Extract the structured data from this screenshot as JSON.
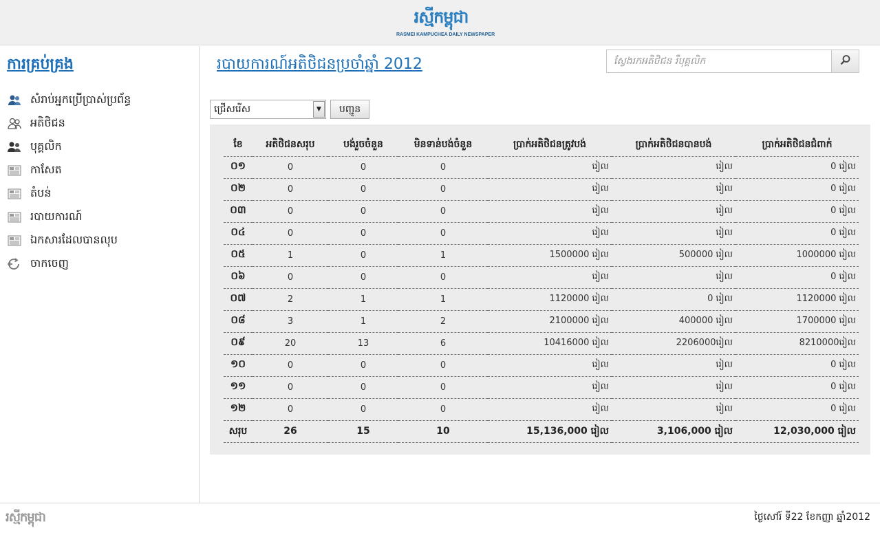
{
  "header": {
    "logo_main": "រស្មីកម្ពុជា",
    "logo_sub": "RASMEI KAMPUCHEA DAILY NEWSPAPER"
  },
  "sidebar": {
    "title": "ការគ្រប់គ្រង",
    "items": [
      {
        "label": "សំរាប់អ្នកប្រើប្រាស់ប្រព័ន្ធ",
        "icon": "users-icon"
      },
      {
        "label": "អតិថិជន",
        "icon": "customers-icon"
      },
      {
        "label": "បុគ្គលិក",
        "icon": "staff-icon"
      },
      {
        "label": "កាសែត",
        "icon": "newspaper-icon"
      },
      {
        "label": "តំបន់",
        "icon": "region-icon"
      },
      {
        "label": "របាយការណ៍",
        "icon": "report-icon"
      },
      {
        "label": "ឯកសារដែលបានលុប",
        "icon": "deleted-docs-icon"
      },
      {
        "label": "ចាកចេញ",
        "icon": "logout-icon"
      }
    ]
  },
  "main": {
    "title": "របាយការណ៍អតិថិជនប្រចាំឆ្នាំ 2012",
    "search": {
      "placeholder": "ស្វែងរកអតិថិជន រឺបុគ្គលិក"
    },
    "filter": {
      "selected": "ជ្រើសរើស",
      "submit_label": "បញ្ជូន"
    }
  },
  "table": {
    "headers": [
      "ខែ",
      "អតិថិជនសរុប",
      "បង់រួចចំនួន",
      "មិនទាន់បង់ចំនួន",
      "ប្រាក់អតិថិជនត្រូវបង់",
      "ប្រាក់អតិថិជនបានបង់",
      "ប្រាក់អតិថិជនជំពាក់"
    ],
    "rows": [
      [
        "០១",
        "0",
        "0",
        "0",
        "រៀល",
        "រៀល",
        "0 រៀល"
      ],
      [
        "០២",
        "0",
        "0",
        "0",
        "រៀល",
        "រៀល",
        "0 រៀល"
      ],
      [
        "០៣",
        "0",
        "0",
        "0",
        "រៀល",
        "រៀល",
        "0 រៀល"
      ],
      [
        "០៤",
        "0",
        "0",
        "0",
        "រៀល",
        "រៀល",
        "0 រៀល"
      ],
      [
        "០៥",
        "1",
        "0",
        "1",
        "1500000 រៀល",
        "500000 រៀល",
        "1000000 រៀល"
      ],
      [
        "០៦",
        "0",
        "0",
        "0",
        "រៀល",
        "រៀល",
        "0 រៀល"
      ],
      [
        "០៧",
        "2",
        "1",
        "1",
        "1120000 រៀល",
        "0 រៀល",
        "1120000 រៀល"
      ],
      [
        "០៨",
        "3",
        "1",
        "2",
        "2100000 រៀល",
        "400000 រៀល",
        "1700000 រៀល"
      ],
      [
        "០៩",
        "20",
        "13",
        "6",
        "10416000 រៀល",
        "2206000រៀល",
        "8210000រៀល"
      ],
      [
        "១០",
        "0",
        "0",
        "0",
        "រៀល",
        "រៀល",
        "0 រៀល"
      ],
      [
        "១១",
        "0",
        "0",
        "0",
        "រៀល",
        "រៀល",
        "0 រៀល"
      ],
      [
        "១២",
        "0",
        "0",
        "0",
        "រៀល",
        "រៀល",
        "0 រៀល"
      ]
    ],
    "total": [
      "សរុប",
      "26",
      "15",
      "10",
      "15,136,000 រៀល",
      "3,106,000 រៀល",
      "12,030,000 រៀល"
    ]
  },
  "footer": {
    "logo": "រស្មីកម្ពុជា",
    "date": "ថ្ងៃសៅរ៍ ទី22 ខែកញ្ញា ឆ្នាំ2012"
  },
  "colors": {
    "accent": "#1d70b7",
    "panel": "#ececec",
    "icon_blue": "#2b5a8c"
  }
}
